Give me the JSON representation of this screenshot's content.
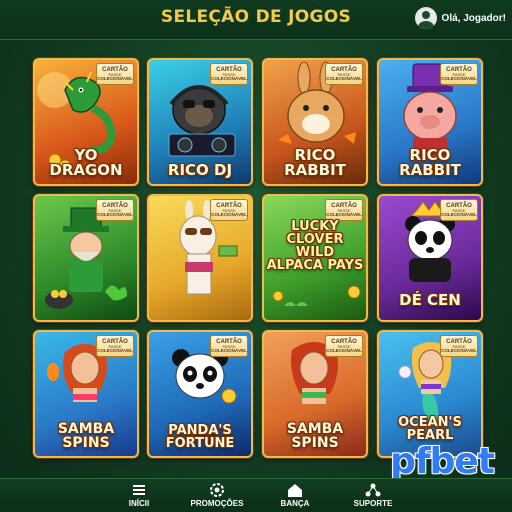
{
  "header": {
    "title": "SELEÇÃO DE JOGOS",
    "user_icon": "user-avatar-icon",
    "user_label": "Olá, Jogador!"
  },
  "badge": {
    "line1": "CARTÃO",
    "line2": "PASSE",
    "line3": "COLECIONÁVEL"
  },
  "games": [
    {
      "title": "YO DRAGON",
      "character": "dragon",
      "bg": "#e08a1e"
    },
    {
      "title": "RICO DJ",
      "character": "gorilla-dj",
      "bg": "#2aa8c8"
    },
    {
      "title": "RICO RABBIT",
      "character": "rabbit",
      "bg": "#d9782a"
    },
    {
      "title": "RICO RABBIT",
      "character": "pig-magician",
      "bg": "#2f8fd6"
    },
    {
      "title": "",
      "character": "leprechaun",
      "bg": "#3a9a3a"
    },
    {
      "title": "",
      "character": "llama",
      "bg": "#e9c23a"
    },
    {
      "title": "LUCKY CLOVER WILD ALPACA PAYS",
      "character": "clover",
      "bg": "#4fae3a"
    },
    {
      "title": "DÉ CEN",
      "character": "panda-king",
      "bg": "#7a2fb0"
    },
    {
      "title": "SAMBA SPINS",
      "character": "samba-dancer",
      "bg": "#2b8fd0"
    },
    {
      "title": "PANDA'S FORTUNE",
      "character": "panda",
      "bg": "#2a6fc0"
    },
    {
      "title": "SAMBA SPINS",
      "character": "samba-mermaid",
      "bg": "#e0783a"
    },
    {
      "title": "OCEAN'S PEARL",
      "character": "mermaid",
      "bg": "#2b9ad6"
    }
  ],
  "nav": [
    {
      "label": "INÍCII",
      "icon": "menu-icon"
    },
    {
      "label": "PROMOÇÕES",
      "icon": "gear-icon"
    },
    {
      "label": "BANÇA",
      "icon": "home-icon"
    },
    {
      "label": "SUPORTE",
      "icon": "support-icon"
    }
  ],
  "brand": "pfbet"
}
